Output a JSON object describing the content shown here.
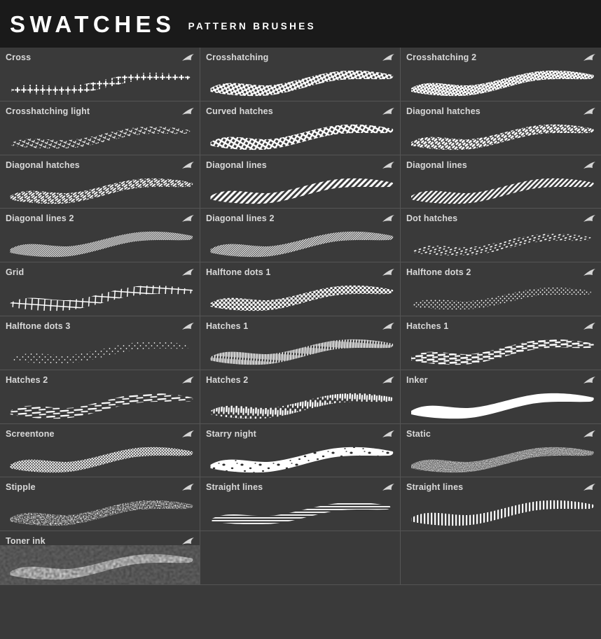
{
  "header": {
    "title": "SWATCHES",
    "subtitle": "PATTERN BRUSHES",
    "background": "#1a1a1a",
    "text_color": "#ffffff"
  },
  "theme": {
    "cell_background": "#3a3a3a",
    "divider_color": "#555555",
    "label_color": "#d9d9d9",
    "stroke_color": "#ffffff"
  },
  "grid": {
    "columns": 3,
    "rows": 11,
    "corner_icon_name": "brush-stroke-mark-icon"
  },
  "swatches": [
    {
      "label": "Cross",
      "pattern": "cross",
      "empty": false
    },
    {
      "label": "Crosshatching",
      "pattern": "crosshatching",
      "empty": false
    },
    {
      "label": "Crosshatching 2",
      "pattern": "crosshatching2",
      "empty": false
    },
    {
      "label": "Crosshatching light",
      "pattern": "crosshatch-light",
      "empty": false
    },
    {
      "label": "Curved hatches",
      "pattern": "curved-hatches",
      "empty": false
    },
    {
      "label": "Diagonal hatches",
      "pattern": "diagonal-hatches",
      "empty": false
    },
    {
      "label": "Diagonal hatches",
      "pattern": "diagonal-hatches2",
      "empty": false
    },
    {
      "label": "Diagonal lines",
      "pattern": "diagonal-lines",
      "empty": false
    },
    {
      "label": "Diagonal lines",
      "pattern": "diagonal-lines-b",
      "empty": false
    },
    {
      "label": "Diagonal lines 2",
      "pattern": "diagonal-lines2",
      "empty": false
    },
    {
      "label": "Diagonal lines 2",
      "pattern": "diagonal-lines2b",
      "empty": false
    },
    {
      "label": "Dot hatches",
      "pattern": "dot-hatches",
      "empty": false
    },
    {
      "label": "Grid",
      "pattern": "grid",
      "empty": false
    },
    {
      "label": "Halftone dots 1",
      "pattern": "halftone1",
      "empty": false
    },
    {
      "label": "Halftone dots 2",
      "pattern": "halftone2",
      "empty": false
    },
    {
      "label": "Halftone dots 3",
      "pattern": "halftone3",
      "empty": false
    },
    {
      "label": "Hatches 1",
      "pattern": "hatches1",
      "empty": false
    },
    {
      "label": "Hatches 1",
      "pattern": "hatches1b",
      "empty": false
    },
    {
      "label": "Hatches 2",
      "pattern": "hatches2",
      "empty": false
    },
    {
      "label": "Hatches 2",
      "pattern": "hatches2b",
      "empty": false
    },
    {
      "label": "Inker",
      "pattern": "inker",
      "empty": false
    },
    {
      "label": "Screentone",
      "pattern": "screentone",
      "empty": false
    },
    {
      "label": "Starry night",
      "pattern": "starry-night",
      "empty": false
    },
    {
      "label": "Static",
      "pattern": "static",
      "empty": false
    },
    {
      "label": "Stipple",
      "pattern": "stipple",
      "empty": false
    },
    {
      "label": "Straight lines",
      "pattern": "straight-lines",
      "empty": false
    },
    {
      "label": "Straight lines",
      "pattern": "straight-lines-b",
      "empty": false
    },
    {
      "label": "Toner ink",
      "pattern": "toner-ink",
      "empty": false
    },
    {
      "label": "",
      "pattern": "",
      "empty": true
    },
    {
      "label": "",
      "pattern": "",
      "empty": true
    }
  ]
}
